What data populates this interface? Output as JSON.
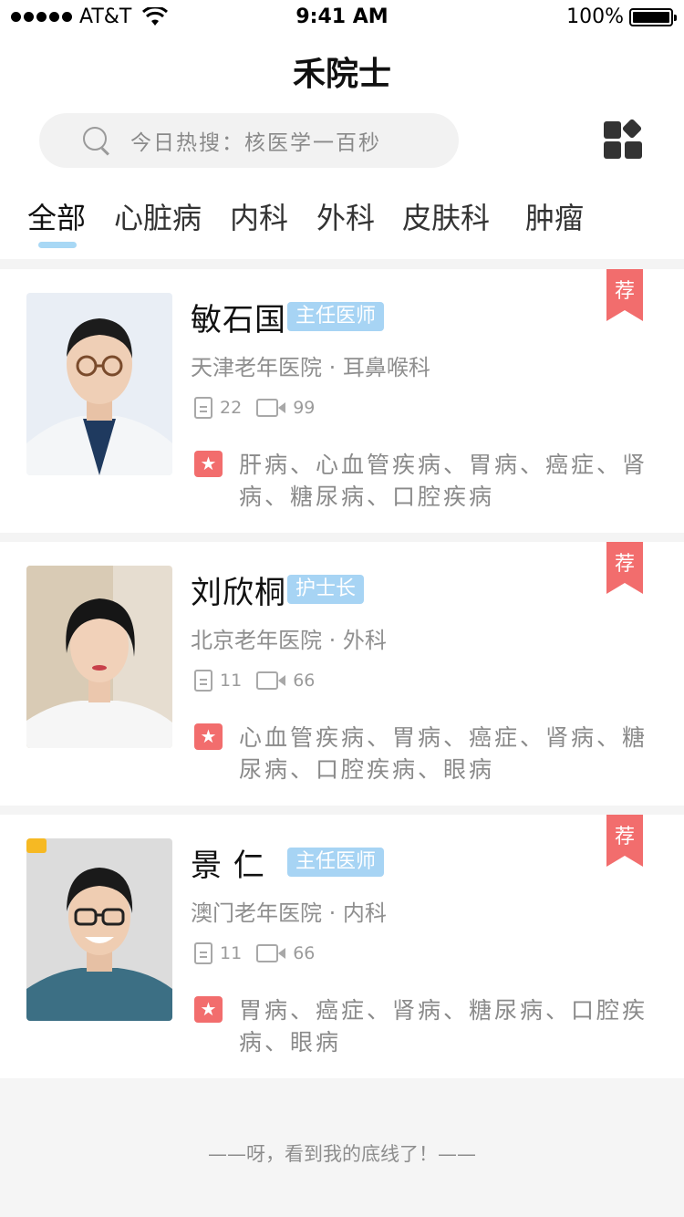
{
  "status_bar": {
    "carrier": "AT&T",
    "time": "9:41 AM",
    "battery": "100%"
  },
  "nav": {
    "title": "禾院士"
  },
  "search": {
    "placeholder": "今日热搜：核医学一百秒"
  },
  "tabs": [
    "全部",
    "心脏病",
    "内科",
    "外科",
    "皮肤科",
    "肿瘤"
  ],
  "active_tab": "全部",
  "doctors": [
    {
      "name": "敏石国",
      "title": "主任医师",
      "hospital": "天津老年医院 · 耳鼻喉科",
      "articles": "22",
      "videos": "99",
      "specialties": "肝病、心血管疾病、胃病、癌症、肾病、糖尿病、口腔疾病",
      "recommend": "荐"
    },
    {
      "name": "刘欣桐",
      "title": "护士长",
      "hospital": "北京老年医院 · 外科",
      "articles": "11",
      "videos": "66",
      "specialties": "心血管疾病、胃病、癌症、肾病、糖尿病、口腔疾病、眼病",
      "recommend": "荐"
    },
    {
      "name": "景 仁",
      "title": "主任医师",
      "hospital": "澳门老年医院 · 内科",
      "articles": "11",
      "videos": "66",
      "specialties": "胃病、癌症、肾病、糖尿病、口腔疾病、眼病",
      "recommend": "荐"
    }
  ],
  "footer": {
    "text": "——呀，看到我的底线了！——"
  },
  "colors": {
    "accent": "#a7d4f4",
    "ribbon": "#f26d6d",
    "tag": "#f26d6d"
  }
}
